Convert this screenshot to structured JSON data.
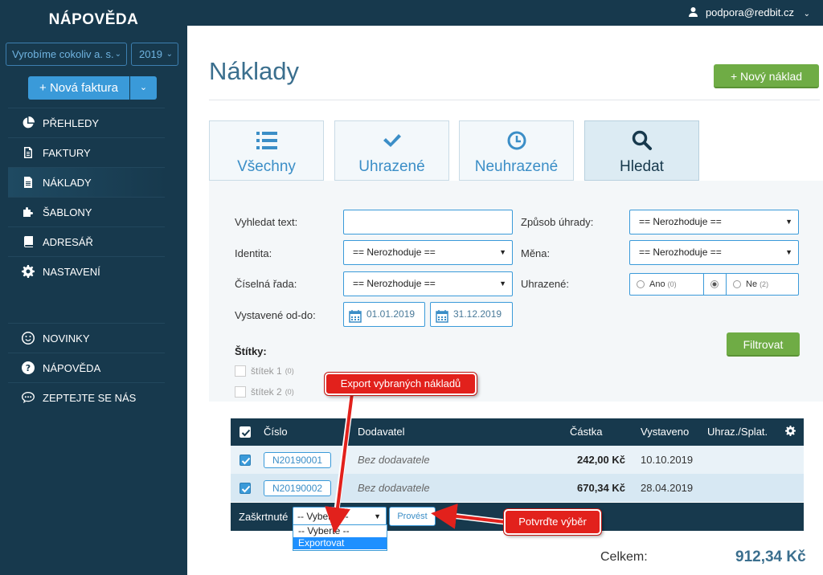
{
  "brand": "NÁPOVĚDA",
  "company_select": "Vyrobíme cokoliv a. s.",
  "year_select": "2019",
  "new_invoice_label": "+ Nová faktura",
  "nav_main": [
    {
      "label": "PŘEHLEDY",
      "icon": "pie-chart-icon"
    },
    {
      "label": "FAKTURY",
      "icon": "document-icon"
    },
    {
      "label": "NÁKLADY",
      "icon": "file-icon"
    },
    {
      "label": "ŠABLONY",
      "icon": "puzzle-icon"
    },
    {
      "label": "ADRESÁŘ",
      "icon": "book-icon"
    },
    {
      "label": "NASTAVENÍ",
      "icon": "gear-icon"
    }
  ],
  "nav_secondary": [
    {
      "label": "NOVINKY",
      "icon": "smiley-icon"
    },
    {
      "label": "NÁPOVĚDA",
      "icon": "question-icon"
    },
    {
      "label": "ZEPTEJTE SE NÁS",
      "icon": "chat-icon"
    }
  ],
  "user_email": "podpora@redbit.cz",
  "page_title": "Náklady",
  "new_cost_label": "+ Nový náklad",
  "tabs": [
    {
      "label": "Všechny",
      "icon": "list-icon"
    },
    {
      "label": "Uhrazené",
      "icon": "check-icon"
    },
    {
      "label": "Neuhrazené",
      "icon": "clock-icon"
    },
    {
      "label": "Hledat",
      "icon": "search-icon"
    }
  ],
  "filters": {
    "search_text_label": "Vyhledat text:",
    "search_text_value": "",
    "identity_label": "Identita:",
    "identity_value": "== Nerozhoduje ==",
    "series_label": "Číselná řada:",
    "series_value": "== Nerozhoduje ==",
    "issued_label": "Vystavené od-do:",
    "date_from": "01.01.2019",
    "date_to": "31.12.2019",
    "payment_method_label": "Způsob úhrady:",
    "payment_method_value": "== Nerozhoduje ==",
    "currency_label": "Měna:",
    "currency_value": "== Nerozhoduje ==",
    "paid_label": "Uhrazené:",
    "paid_yes": "Ano",
    "paid_yes_count": "(0)",
    "paid_no": "Ne",
    "paid_no_count": "(2)",
    "filter_button": "Filtrovat"
  },
  "tags": {
    "title": "Štítky:",
    "items": [
      {
        "label": "štítek 1",
        "count": "(0)"
      },
      {
        "label": "štítek 2",
        "count": "(0)"
      }
    ]
  },
  "table": {
    "headers": {
      "number": "Číslo",
      "supplier": "Dodavatel",
      "amount": "Částka",
      "issued": "Vystaveno",
      "paid_due": "Uhraz./Splat."
    },
    "rows": [
      {
        "number": "N20190001",
        "supplier": "Bez dodavatele",
        "amount": "242,00 Kč",
        "issued": "10.10.2019"
      },
      {
        "number": "N20190002",
        "supplier": "Bez dodavatele",
        "amount": "670,34 Kč",
        "issued": "28.04.2019"
      }
    ],
    "checked_label": "Zaškrtnuté",
    "action_select": "-- Vyberte --",
    "action_options": [
      "-- Vyberte --",
      "Exportovat"
    ],
    "execute_button": "Provést",
    "total_label": "Celkem:",
    "total_value": "912,34 Kč"
  },
  "callouts": {
    "export": "Export vybraných nákladů",
    "confirm": "Potvrďte výběr"
  }
}
